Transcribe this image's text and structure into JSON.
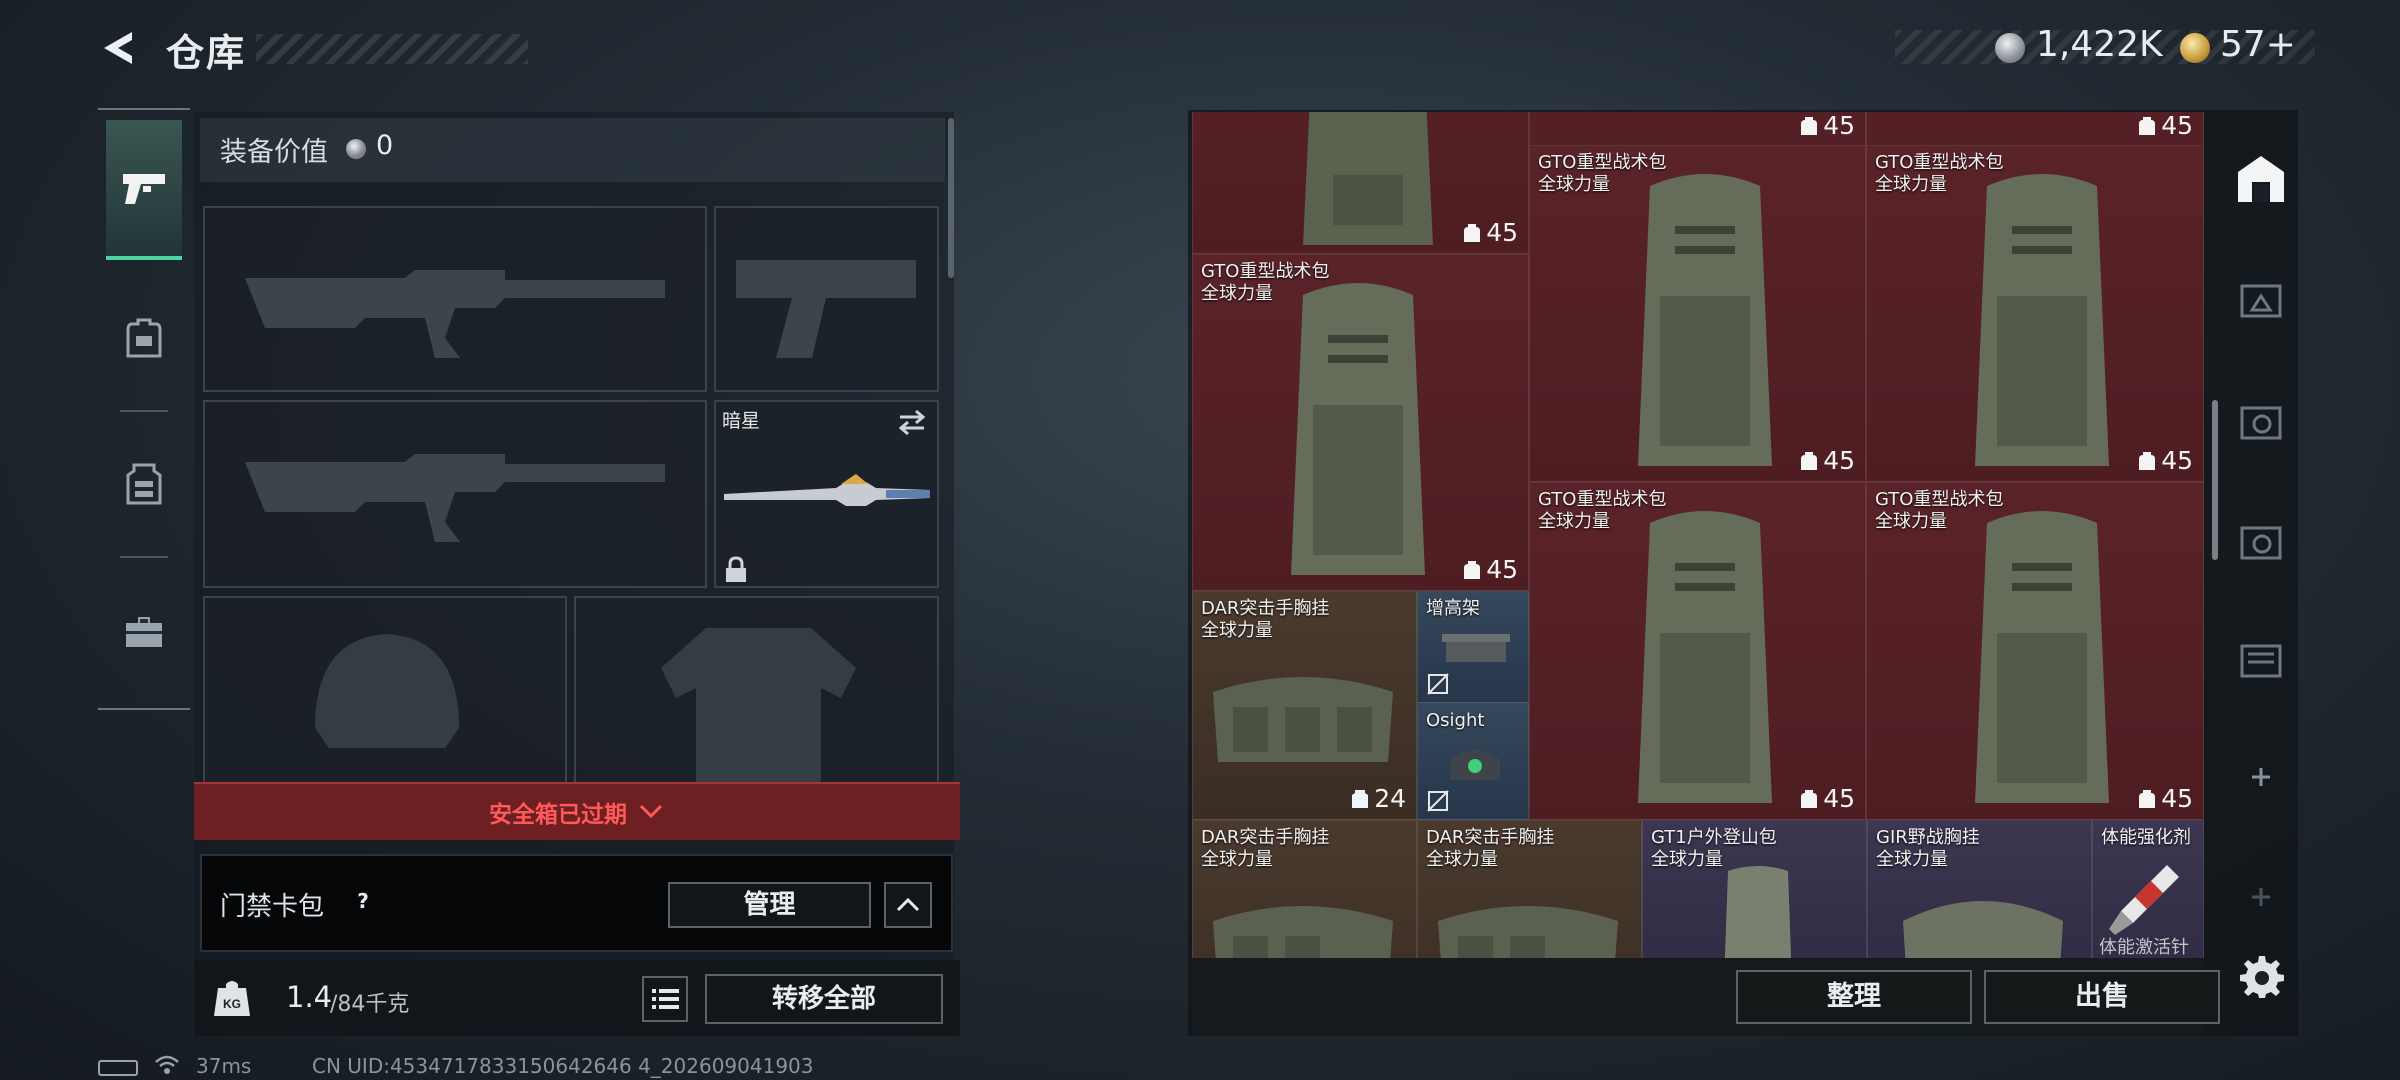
{
  "header": {
    "title": "仓库"
  },
  "currency": {
    "silver": "1,422K",
    "gold": "57+"
  },
  "equipment": {
    "value_label": "装备价值",
    "value": "0",
    "melee_name": "暗星"
  },
  "safe_box": {
    "status": "安全箱已过期"
  },
  "access_card": {
    "label": "门禁卡包",
    "help": "?",
    "manage": "管理"
  },
  "weight": {
    "current": "1.4",
    "max": "/84千克"
  },
  "buttons": {
    "transfer_all": "转移全部",
    "sort": "整理",
    "sell": "出售"
  },
  "status": {
    "ping": "37ms",
    "uid": "CN UID:4534717833150642646 4_202609041903"
  },
  "stash": {
    "items": [
      {
        "name": "",
        "sub": "",
        "cap": "45"
      },
      {
        "name": "",
        "sub": "",
        "cap": "45"
      },
      {
        "name": "",
        "sub": "",
        "cap": "45"
      },
      {
        "name": "GTO重型战术包",
        "sub": "全球力量",
        "cap": "45"
      },
      {
        "name": "GTO重型战术包",
        "sub": "全球力量",
        "cap": "45"
      },
      {
        "name": "GTO重型战术包",
        "sub": "全球力量",
        "cap": "45"
      },
      {
        "name": "GTO重型战术包",
        "sub": "全球力量",
        "cap": "45"
      },
      {
        "name": "GTO重型战术包",
        "sub": "全球力量",
        "cap": "45"
      },
      {
        "name": "DAR突击手胸挂",
        "sub": "全球力量",
        "cap": "24"
      },
      {
        "name": "增高架",
        "sub": ""
      },
      {
        "name": "Osight",
        "sub": ""
      },
      {
        "name": "DAR突击手胸挂",
        "sub": "全球力量"
      },
      {
        "name": "DAR突击手胸挂",
        "sub": "全球力量"
      },
      {
        "name": "GT1户外登山包",
        "sub": "全球力量"
      },
      {
        "name": "GIR野战胸挂",
        "sub": "全球力量"
      },
      {
        "name": "体能强化剂",
        "sub": "",
        "bottom": "体能激活针"
      }
    ]
  }
}
